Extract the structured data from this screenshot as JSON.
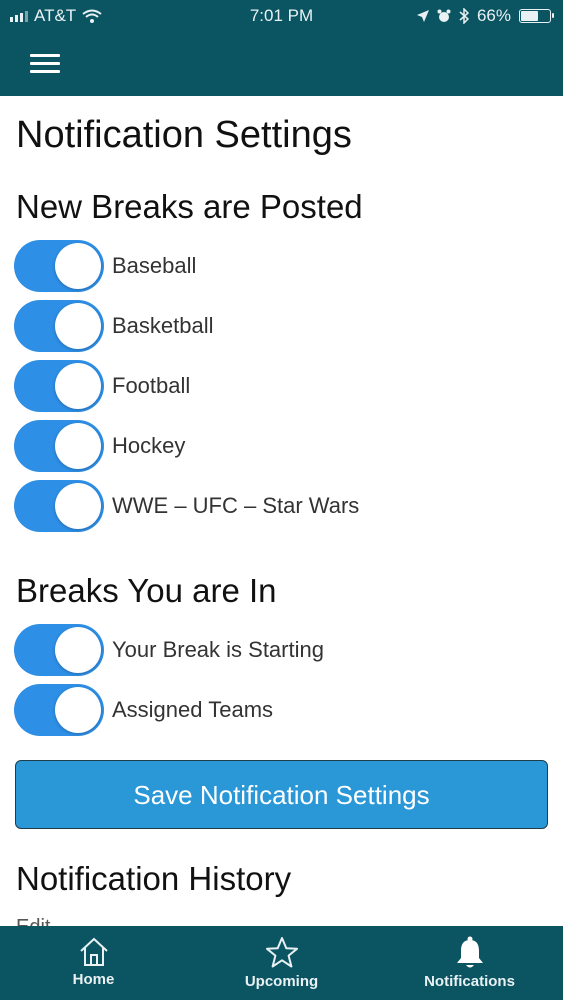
{
  "status_bar": {
    "carrier": "AT&T",
    "time": "7:01 PM",
    "battery_percent": "66%",
    "battery_level": 0.66,
    "icons": [
      "signal-icon",
      "wifi-icon",
      "location-icon",
      "alarm-icon",
      "bluetooth-icon",
      "battery-icon"
    ]
  },
  "header": {
    "menu_icon": "hamburger-menu-icon",
    "background_color": "#0b5563"
  },
  "main": {
    "title": "Notification Settings",
    "new_breaks": {
      "title": "New Breaks are Posted",
      "toggles": [
        {
          "label": "Baseball",
          "on": true
        },
        {
          "label": "Basketball",
          "on": true
        },
        {
          "label": "Football",
          "on": true
        },
        {
          "label": "Hockey",
          "on": true
        },
        {
          "label": "WWE – UFC – Star Wars",
          "on": true
        }
      ]
    },
    "breaks_you_are_in": {
      "title": "Breaks You are In",
      "toggles": [
        {
          "label": "Your Break is Starting",
          "on": true
        },
        {
          "label": "Assigned Teams",
          "on": true
        }
      ]
    },
    "save_button": "Save Notification Settings",
    "history_title": "Notification History",
    "history_partial": "Edit"
  },
  "tab_bar": {
    "tabs": [
      {
        "label": "Home",
        "icon": "home-icon"
      },
      {
        "label": "Upcoming",
        "icon": "star-icon"
      },
      {
        "label": "Notifications",
        "icon": "bell-icon",
        "active": true
      }
    ]
  },
  "colors": {
    "accent": "#2e8fe6",
    "button": "#2a97d6",
    "bar": "#0b5563"
  }
}
